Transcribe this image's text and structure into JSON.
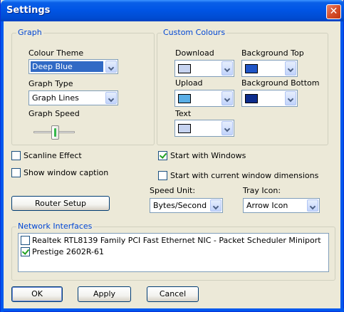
{
  "window": {
    "title": "Settings"
  },
  "graph": {
    "group_label": "Graph",
    "colour_theme_label": "Colour Theme",
    "colour_theme_value": "Deep Blue",
    "graph_type_label": "Graph Type",
    "graph_type_value": "Graph Lines",
    "graph_speed_label": "Graph Speed",
    "graph_speed_level": 0.55
  },
  "custom_colours": {
    "group_label": "Custom Colours",
    "download_label": "Download",
    "download_color": "#c6d3f0",
    "background_top_label": "Background Top",
    "background_top_color": "#1f55c7",
    "upload_label": "Upload",
    "upload_color": "#5aaee6",
    "background_bottom_label": "Background Bottom",
    "background_bottom_color": "#0c2c8c",
    "text_label": "Text",
    "text_color": "#c6d3f0"
  },
  "options": {
    "scanline_effect": {
      "label": "Scanline Effect",
      "checked": false
    },
    "show_window_caption": {
      "label": "Show window caption",
      "checked": false
    },
    "start_with_windows": {
      "label": "Start with Windows",
      "checked": true
    },
    "start_with_dimensions": {
      "label": "Start with current window dimensions",
      "checked": false
    }
  },
  "router_setup_label": "Router Setup",
  "speed_unit": {
    "label": "Speed Unit:",
    "value": "Bytes/Second"
  },
  "tray_icon": {
    "label": "Tray Icon:",
    "value": "Arrow Icon"
  },
  "network": {
    "group_label": "Network Interfaces",
    "items": [
      {
        "label": "Realtek RTL8139 Family PCI Fast Ethernet NIC - Packet Scheduler Miniport",
        "checked": false
      },
      {
        "label": "Prestige 2602R-61",
        "checked": true
      }
    ]
  },
  "buttons": {
    "ok": "OK",
    "apply": "Apply",
    "cancel": "Cancel"
  }
}
